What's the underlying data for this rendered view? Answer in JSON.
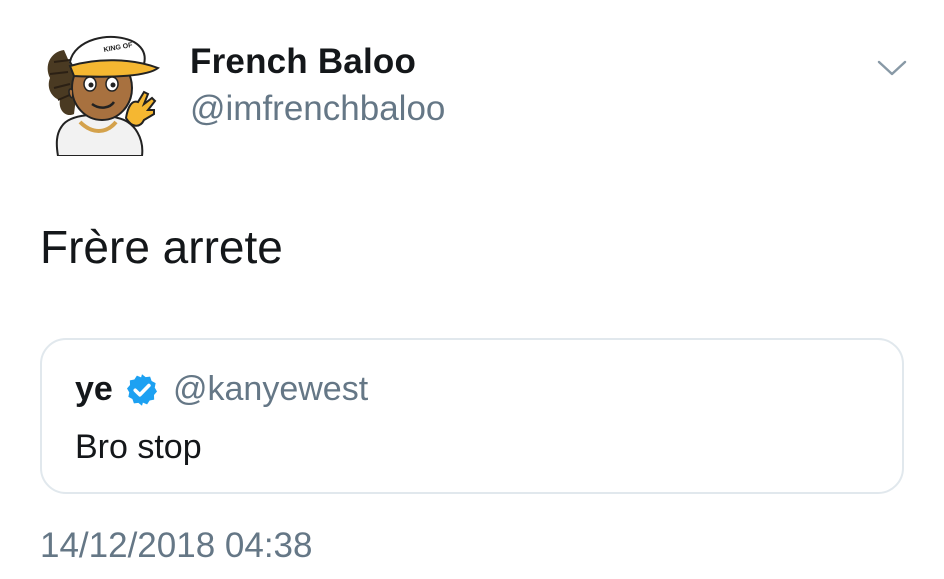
{
  "tweet": {
    "author": {
      "name": "French Baloo",
      "handle": "@imfrenchbaloo",
      "avatar_icon": "cartoon-avatar-yellow-cap"
    },
    "menu_icon": "chevron-down-icon",
    "text": "Frère arrete",
    "quoted_tweet": {
      "name": "ye",
      "verified_icon": "verified-badge-icon",
      "handle": "@kanyewest",
      "text": "Bro stop"
    },
    "timestamp": "14/12/2018 04:38"
  },
  "colors": {
    "text_primary": "#14171a",
    "text_secondary": "#657786",
    "verified_blue": "#1da1f2",
    "card_border": "#e1e8ed",
    "avatar_cap_yellow": "#f5b731"
  }
}
